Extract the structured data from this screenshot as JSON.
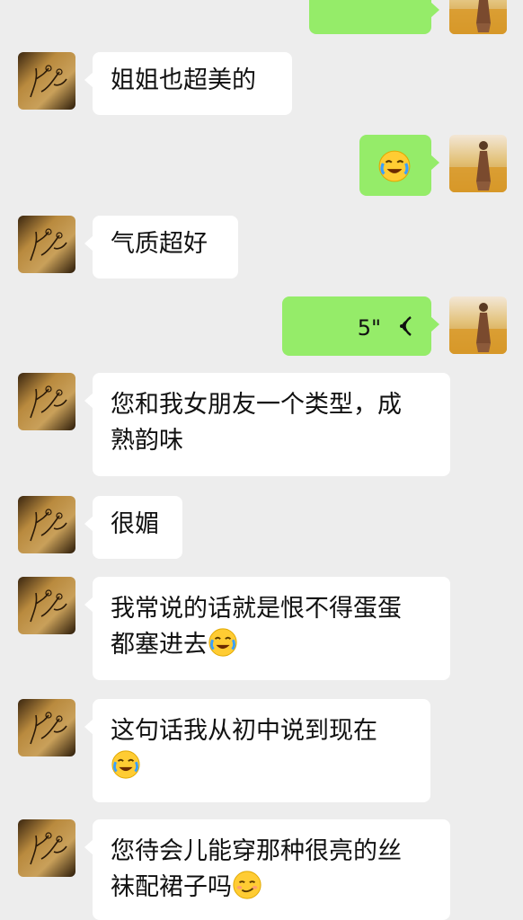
{
  "messages": [
    {
      "id": "m0",
      "side": "mine",
      "text": "",
      "partial": true
    },
    {
      "id": "m1",
      "side": "theirs",
      "text": "姐姐也超美的"
    },
    {
      "id": "m2",
      "side": "mine",
      "type": "emoji",
      "emoji": "crying-face-emoji"
    },
    {
      "id": "m3",
      "side": "theirs",
      "text": "气质超好"
    },
    {
      "id": "m4",
      "side": "mine",
      "type": "voice",
      "duration": "5\""
    },
    {
      "id": "m5",
      "side": "theirs",
      "lines": [
        "您和我女朋友一个类型，成",
        "熟韵味"
      ]
    },
    {
      "id": "m6",
      "side": "theirs",
      "text": "很媚"
    },
    {
      "id": "m7",
      "side": "theirs",
      "lines": [
        "我常说的话就是恨不得蛋蛋",
        "都塞进去"
      ],
      "trailing_emoji": "tears-of-joy-emoji"
    },
    {
      "id": "m8",
      "side": "theirs",
      "lines": [
        "这句话我从初中说到现在"
      ],
      "second_line_emoji": "tears-of-joy-emoji"
    },
    {
      "id": "m9",
      "side": "theirs",
      "lines": [
        "您待会儿能穿那种很亮的丝",
        "袜配裙子吗"
      ],
      "trailing_emoji": "smirk-emoji"
    }
  ],
  "colors": {
    "background": "#ededed",
    "mine_bubble": "#95ec69",
    "theirs_bubble": "#ffffff"
  }
}
